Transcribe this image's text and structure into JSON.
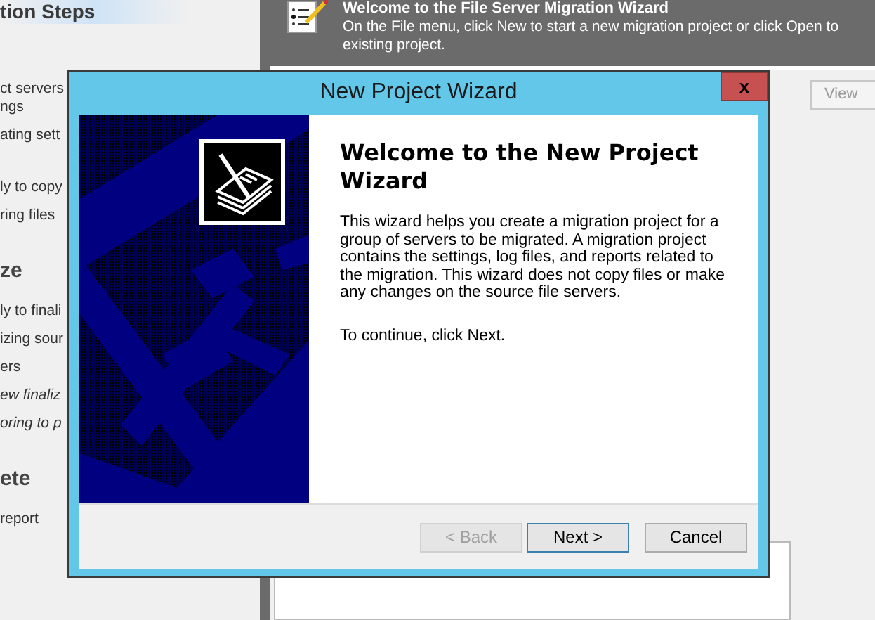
{
  "left_panel": {
    "heading": "tion Steps",
    "groups": [
      {
        "items": [
          {
            "lines": [
              "ct servers",
              "ngs"
            ],
            "kind": "step"
          },
          {
            "lines": [
              "ating sett"
            ],
            "kind": "step"
          }
        ]
      },
      {
        "items": [
          {
            "lines": [
              "ly to copy"
            ],
            "kind": "step"
          },
          {
            "lines": [
              "ring files"
            ],
            "kind": "step"
          }
        ]
      },
      {
        "title": "ze",
        "items": [
          {
            "lines": [
              "ly to finali"
            ],
            "kind": "step"
          },
          {
            "lines": [
              "izing sour"
            ],
            "kind": "step"
          },
          {
            "lines": [
              "ers"
            ],
            "kind": "step"
          },
          {
            "lines": [
              "ew finaliz"
            ],
            "kind": "note"
          },
          {
            "lines": [
              "oring to p"
            ],
            "kind": "note"
          }
        ]
      },
      {
        "title": "ete",
        "items": [
          {
            "lines": [
              "report"
            ],
            "kind": "step"
          }
        ]
      }
    ]
  },
  "header": {
    "title": "Welcome to the File Server Migration Wizard",
    "description_lines": [
      "On the File menu, click New to start a new migration project or click Open to",
      "existing project."
    ]
  },
  "view_button": {
    "label": "View",
    "disabled": true
  },
  "dialog": {
    "title": "New Project Wizard",
    "close_label": "x",
    "heading": "Welcome to the New Project Wizard",
    "body": "This wizard helps you create a migration project for a group of servers to be migrated. A migration project contains the settings, log files, and reports related to the migration. This wizard does not copy files or make any changes on the source file servers.",
    "hint": "To continue, click Next.",
    "buttons": [
      {
        "label": "< Back",
        "disabled": true,
        "default": false
      },
      {
        "label": "Next >",
        "disabled": false,
        "default": true
      },
      {
        "label": "Cancel",
        "disabled": false,
        "default": false
      }
    ]
  }
}
